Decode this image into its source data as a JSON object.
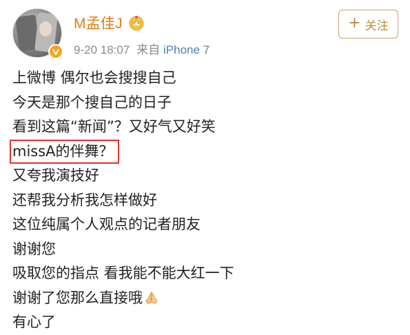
{
  "post": {
    "author": {
      "name": "M孟佳J",
      "avatar_icon": "avatar-photo",
      "verified_badge_color": "#f7a41a",
      "vip_icon": "vip-crown-icon"
    },
    "meta": {
      "time": "9-20 18:07",
      "source_prefix": "来自",
      "device": "iPhone 7"
    },
    "follow_button": {
      "icon": "+",
      "label": "关注"
    },
    "lines": [
      "上微博 偶尔也会搜搜自己",
      "今天是那个搜自己的日子",
      "看到这篇“新闻”？又好气又好笑",
      "missA的伴舞？",
      "又夸我演技好",
      "还帮我分析我怎样做好",
      "这位纯属个人观点的记者朋友",
      "谢谢您",
      "吸取您的指点 看我能不能大红一下",
      "谢谢了您那么直接哦",
      "有心了"
    ],
    "highlighted_line_index": 3,
    "emoji_after_line_index": 9,
    "emoji_name": "praying-hands-icon"
  },
  "colors": {
    "username": "#e07b14",
    "follow_border": "#c9a36a",
    "highlight_box": "#e0322f",
    "device_link": "#4f7fb3"
  }
}
